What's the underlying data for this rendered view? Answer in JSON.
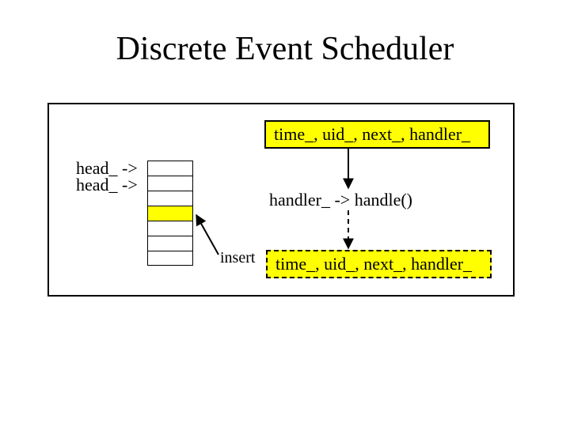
{
  "title": "Discrete Event Scheduler",
  "head_label_1": "head_ ->",
  "head_label_2": "head_ ->",
  "event_box_top": "time_, uid_, next_, handler_",
  "handler_text": "handler_ -> handle()",
  "event_box_bottom": "time_, uid_, next_, handler_",
  "insert_label": "insert"
}
